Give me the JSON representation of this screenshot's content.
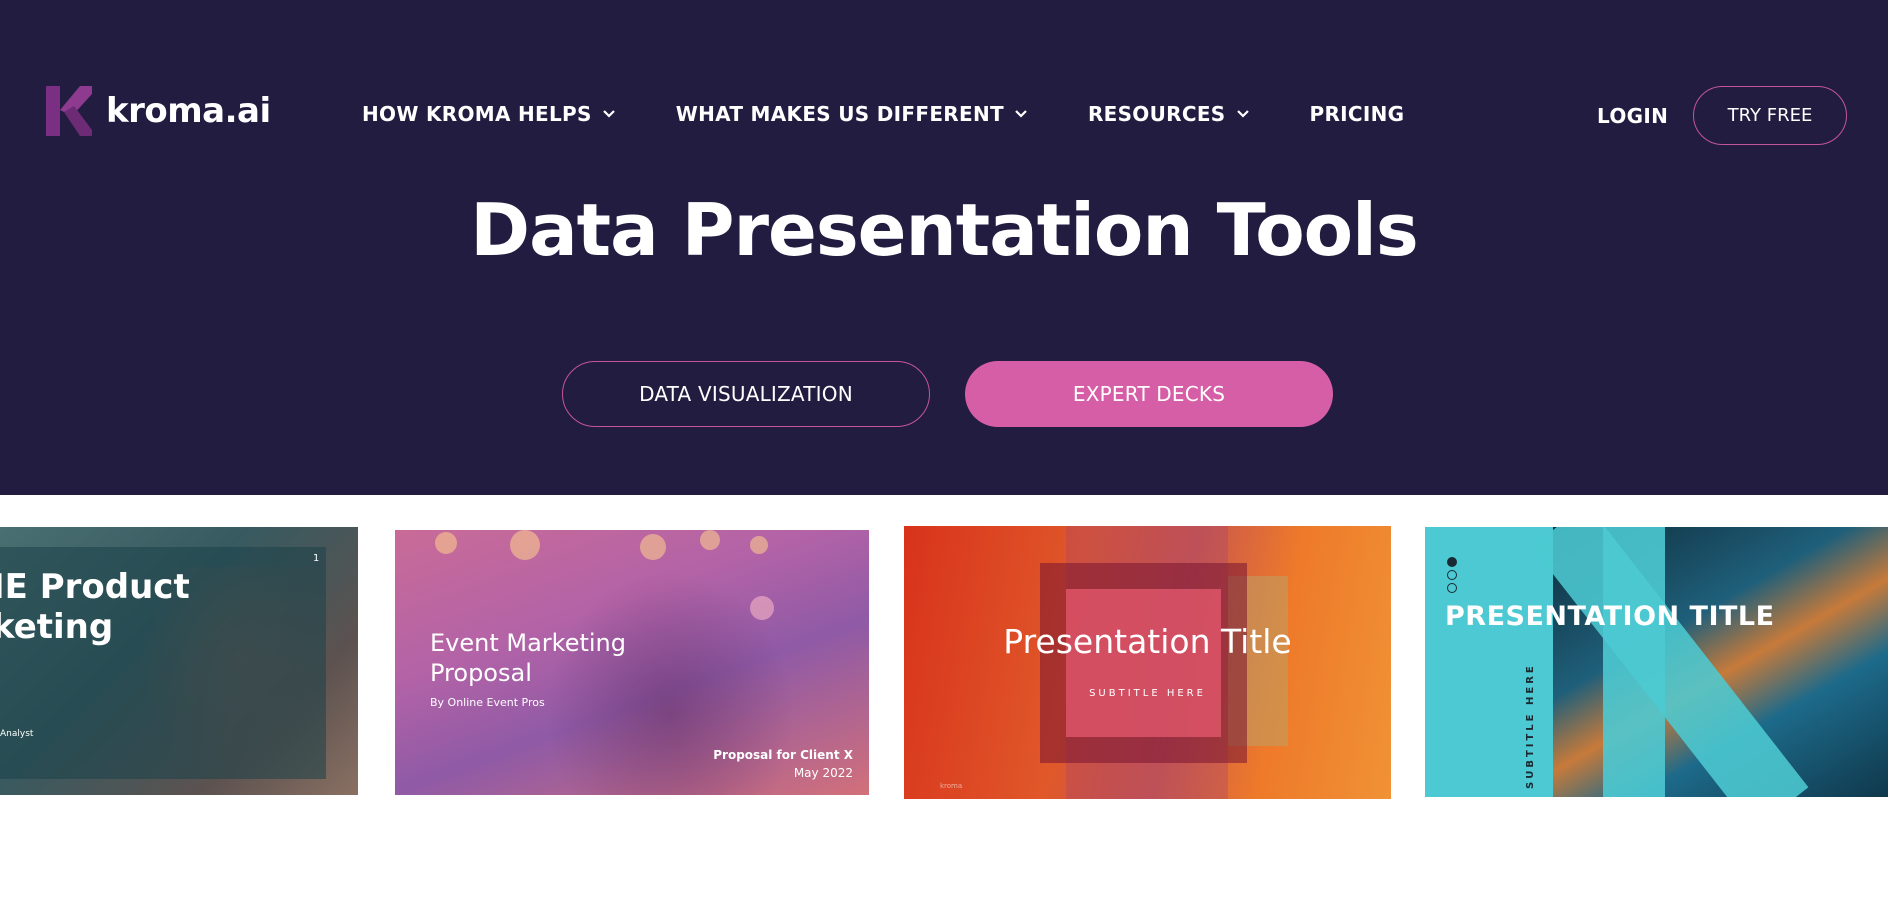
{
  "header": {
    "logo_text": "kroma.ai",
    "nav": [
      {
        "label": "HOW KROMA HELPS",
        "has_dropdown": true
      },
      {
        "label": "WHAT MAKES US DIFFERENT",
        "has_dropdown": true
      },
      {
        "label": "RESOURCES",
        "has_dropdown": true
      },
      {
        "label": "PRICING",
        "has_dropdown": false
      }
    ],
    "login_label": "LOGIN",
    "try_free_label": "TRY FREE"
  },
  "hero": {
    "title": "Data Presentation Tools",
    "buttons": {
      "data_visualization": "DATA VISUALIZATION",
      "expert_decks": "EXPERT DECKS"
    }
  },
  "carousel": {
    "slide1": {
      "title_line1": "IE Product",
      "title_line2": "keting",
      "page_number": "1",
      "footer": "Analyst"
    },
    "slide2": {
      "title_line1": "Event Marketing",
      "title_line2": "Proposal",
      "byline": "By Online Event Pros",
      "client": "Proposal for Client X",
      "date": "May 2022"
    },
    "slide3": {
      "title": "Presentation Title",
      "subtitle": "SUBTITLE HERE",
      "footer": "kroma"
    },
    "slide4": {
      "title": "PRESENTATION TITLE",
      "subtitle": "SUBTITLE HERE"
    }
  },
  "colors": {
    "hero_bg": "#221c40",
    "accent_pink": "#d65ea6",
    "outline_pink": "#c4559b",
    "logo_purple": "#7a2f82"
  }
}
